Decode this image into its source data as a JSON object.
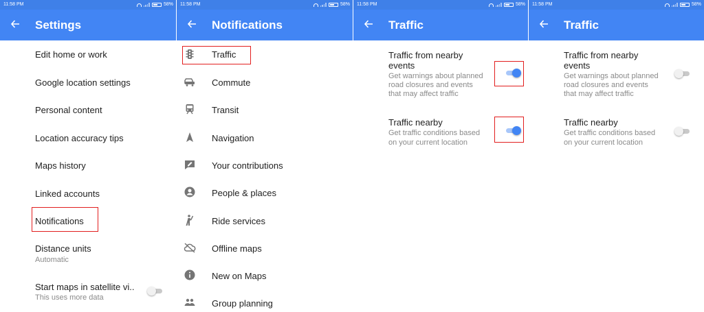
{
  "status_bar": {
    "time": "11:58 PM",
    "battery": "58%"
  },
  "colors": {
    "appbar": "#4285f4",
    "status": "#3f80e8",
    "toggle_on": "#4285f4",
    "highlight": "#e21d1d"
  },
  "panel1": {
    "title": "Settings",
    "items": [
      {
        "label": "Edit home or work"
      },
      {
        "label": "Google location settings"
      },
      {
        "label": "Personal content"
      },
      {
        "label": "Location accuracy tips"
      },
      {
        "label": "Maps history"
      },
      {
        "label": "Linked accounts"
      },
      {
        "label": "Notifications"
      },
      {
        "label": "Distance units",
        "sub": "Automatic"
      },
      {
        "label": "Start maps in satellite vi..",
        "sub": "This uses more data",
        "toggle": "off"
      }
    ]
  },
  "panel2": {
    "title": "Notifications",
    "items": [
      {
        "label": "Traffic",
        "icon": "traffic-light-icon"
      },
      {
        "label": "Commute",
        "icon": "car-icon"
      },
      {
        "label": "Transit",
        "icon": "train-icon"
      },
      {
        "label": "Navigation",
        "icon": "navigation-arrow-icon"
      },
      {
        "label": "Your contributions",
        "icon": "edit-contribution-icon"
      },
      {
        "label": "People & places",
        "icon": "person-icon"
      },
      {
        "label": "Ride services",
        "icon": "hail-ride-icon"
      },
      {
        "label": "Offline maps",
        "icon": "cloud-off-icon"
      },
      {
        "label": "New on Maps",
        "icon": "info-icon"
      },
      {
        "label": "Group planning",
        "icon": "group-icon"
      }
    ]
  },
  "panel3": {
    "title": "Traffic",
    "settings": [
      {
        "title_l1": "Traffic from nearby",
        "title_l2": "events",
        "desc_l1": "Get warnings about planned",
        "desc_l2": "road closures and events",
        "desc_l3": "that may affect traffic",
        "state": "on"
      },
      {
        "title_l1": "Traffic nearby",
        "desc_l1": "Get traffic conditions based",
        "desc_l2": "on your current location",
        "state": "on"
      }
    ]
  },
  "panel4": {
    "title": "Traffic",
    "settings": [
      {
        "title_l1": "Traffic from nearby",
        "title_l2": "events",
        "desc_l1": "Get warnings about planned",
        "desc_l2": "road closures and events",
        "desc_l3": "that may affect traffic",
        "state": "off"
      },
      {
        "title_l1": "Traffic nearby",
        "desc_l1": "Get traffic conditions based",
        "desc_l2": "on your current location",
        "state": "off"
      }
    ]
  }
}
